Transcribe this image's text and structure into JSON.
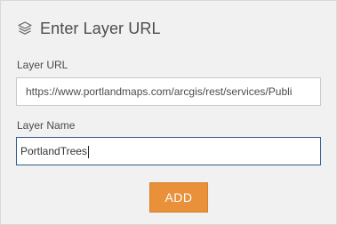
{
  "header": {
    "title": "Enter Layer URL",
    "icon": "layers-icon"
  },
  "form": {
    "url_label": "Layer URL",
    "url_value": "https://www.portlandmaps.com/arcgis/rest/services/Publi",
    "name_label": "Layer Name",
    "name_value": "PortlandTrees"
  },
  "actions": {
    "add_label": "ADD"
  },
  "colors": {
    "panel_background": "#f1f1f1",
    "accent": "#e8913a",
    "focus_border": "#2f5b8f",
    "text": "#4c4c4c"
  }
}
